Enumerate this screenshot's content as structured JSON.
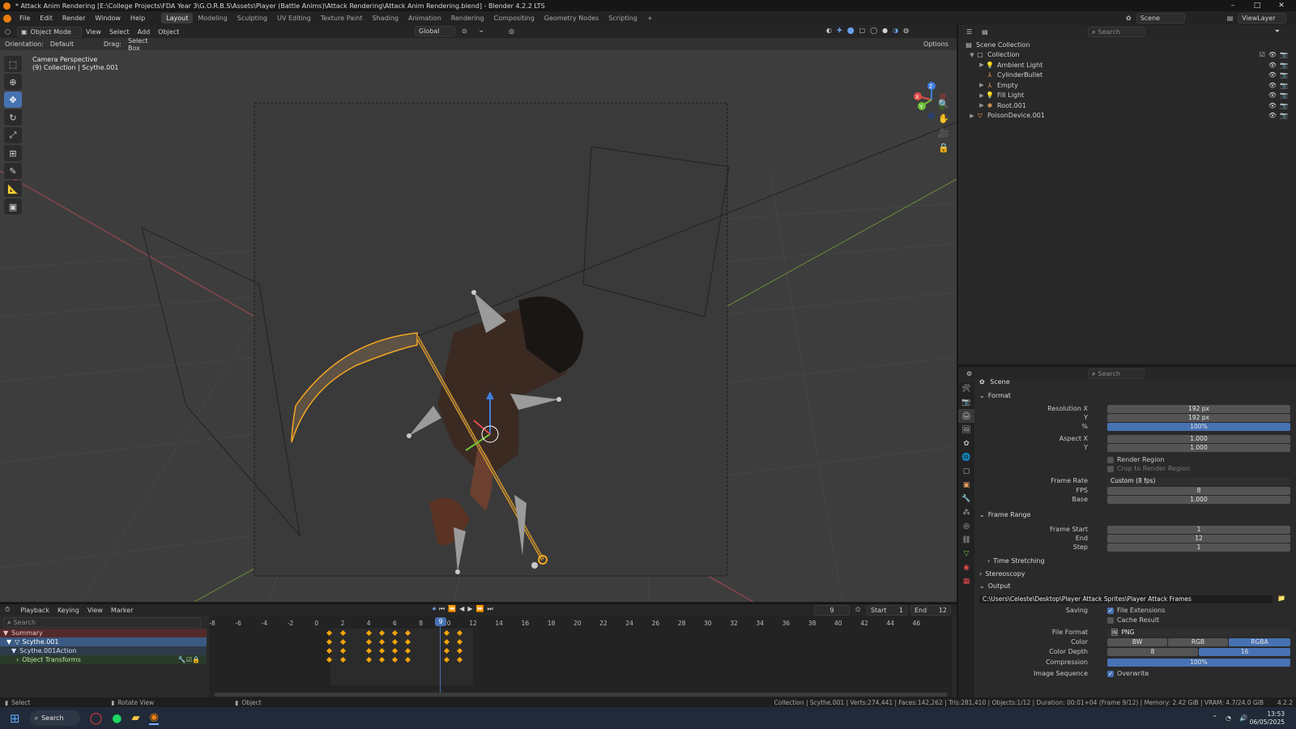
{
  "window": {
    "title": "* Attack Anim Rendering [E:\\College Projects\\FDA Year 3\\G.O.R.B.S\\Assets\\Player (Battle Anims)\\Attack Rendering\\Attack Anim Rendering.blend] - Blender 4.2.2 LTS",
    "minimize": "–",
    "maximize": "□",
    "close": "✕"
  },
  "menubar": {
    "menus": [
      "File",
      "Edit",
      "Render",
      "Window",
      "Help"
    ],
    "workspaces": [
      "Layout",
      "Modeling",
      "Sculpting",
      "UV Editing",
      "Texture Paint",
      "Shading",
      "Animation",
      "Rendering",
      "Compositing",
      "Geometry Nodes",
      "Scripting"
    ],
    "add_tab": "+",
    "scene_label": "Scene",
    "view_layer_label": "ViewLayer"
  },
  "viewport": {
    "mode": "Object Mode",
    "menus": [
      "View",
      "Select",
      "Add",
      "Object"
    ],
    "transform_orientation": "Global",
    "orientation_label": "Orientation:",
    "orientation_value": "Default",
    "drag_label": "Drag:",
    "drag_value": "Select Box",
    "options_label": "Options",
    "overlay_title": "Camera Perspective",
    "overlay_subtitle": "(9) Collection | Scythe.001",
    "gizmo_x": "X",
    "gizmo_y": "Y",
    "gizmo_z": "Z"
  },
  "outliner": {
    "search_placeholder": "Search",
    "scene_collection": "Scene Collection",
    "items": [
      {
        "label": "Collection",
        "indent": 1
      },
      {
        "label": "Ambient Light",
        "indent": 2
      },
      {
        "label": "CylinderBullet",
        "indent": 2
      },
      {
        "label": "Empty",
        "indent": 2
      },
      {
        "label": "Fill Light",
        "indent": 2
      },
      {
        "label": "Root.001",
        "indent": 2
      },
      {
        "label": "PoisonDevice.001",
        "indent": 1
      }
    ]
  },
  "properties": {
    "search_placeholder": "Search",
    "context": "Scene",
    "format_section": "Format",
    "resolution_x_label": "Resolution X",
    "resolution_x": "192 px",
    "resolution_y_label": "Y",
    "resolution_y": "192 px",
    "resolution_pct_label": "%",
    "resolution_pct": "100%",
    "aspect_x_label": "Aspect X",
    "aspect_x": "1.000",
    "aspect_y_label": "Y",
    "aspect_y": "1.000",
    "render_region": "Render Region",
    "crop_region": "Crop to Render Region",
    "frame_rate_label": "Frame Rate",
    "frame_rate": "Custom (8 fps)",
    "fps_label": "FPS",
    "fps": "8",
    "base_label": "Base",
    "base": "1.000",
    "frame_range_section": "Frame Range",
    "frame_start_label": "Frame Start",
    "frame_start": "1",
    "end_label": "End",
    "end": "12",
    "step_label": "Step",
    "step": "1",
    "time_stretching": "Time Stretching",
    "stereoscopy": "Stereoscopy",
    "output_section": "Output",
    "output_path": "C:\\Users\\Celeste\\Desktop\\Player Attack Sprites\\Player Attack Frames",
    "saving_label": "Saving",
    "file_extensions": "File Extensions",
    "cache_result": "Cache Result",
    "file_format_label": "File Format",
    "file_format": "PNG",
    "color_label": "Color",
    "color_options": [
      "BW",
      "RGB",
      "RGBA"
    ],
    "color_depth_label": "Color Depth",
    "color_depth_options": [
      "8",
      "16"
    ],
    "compression_label": "Compression",
    "compression": "100%",
    "image_sequence_label": "Image Sequence",
    "overwrite": "Overwrite"
  },
  "timeline": {
    "menus": [
      "Playback",
      "Keying",
      "View",
      "Marker"
    ],
    "search_placeholder": "Search",
    "current_frame": "9",
    "start_label": "Start",
    "start": "1",
    "end_label": "End",
    "end": "12",
    "ticks": [
      "-8",
      "-6",
      "-4",
      "-2",
      "0",
      "2",
      "4",
      "6",
      "8",
      "10",
      "12",
      "14",
      "16",
      "18",
      "20",
      "22",
      "24",
      "26",
      "28",
      "30",
      "32",
      "34",
      "36",
      "38",
      "40",
      "42",
      "44",
      "46"
    ],
    "playhead": "9",
    "channels": [
      "Summary",
      "Scythe.001",
      "Scythe.001Action",
      "Object Transforms"
    ]
  },
  "statusbar": {
    "select": "Select",
    "rotate_view": "Rotate View",
    "object": "Object",
    "stats": "Collection | Scythe.001 | Verts:274,441 | Faces:142,262 | Tris:281,410 | Objects:1/12 | Duration: 00:01+04 (Frame 9/12) | Memory: 2.42 GiB | VRAM: 4.7/24.0 GiB",
    "version": "4.2.2"
  },
  "taskbar": {
    "search": "Search",
    "time": "13:53",
    "date": "06/05/2025"
  },
  "colors": {
    "accent": "#4772b3",
    "keyframe": "#f3a40a",
    "selection_outline": "#f5a623"
  }
}
